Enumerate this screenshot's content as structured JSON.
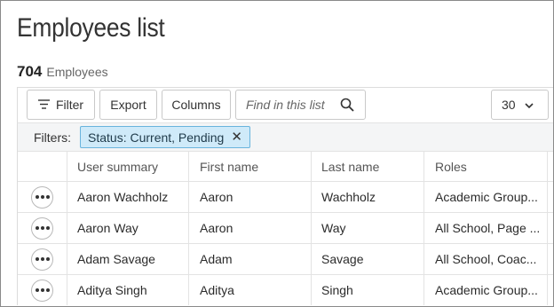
{
  "page": {
    "title": "Employees list",
    "count": "704",
    "count_label": "Employees"
  },
  "toolbar": {
    "filter_label": "Filter",
    "export_label": "Export",
    "columns_label": "Columns",
    "search_placeholder": "Find in this list",
    "page_size": "30"
  },
  "filters": {
    "label": "Filters:",
    "chips": [
      {
        "text": "Status: Current, Pending"
      }
    ]
  },
  "table": {
    "columns": [
      "User summary",
      "First name",
      "Last name",
      "Roles"
    ],
    "rows": [
      {
        "summary": "Aaron Wachholz",
        "first": "Aaron",
        "last": "Wachholz",
        "roles": "Academic Group..."
      },
      {
        "summary": "Aaron Way",
        "first": "Aaron",
        "last": "Way",
        "roles": "All School, Page ..."
      },
      {
        "summary": "Adam Savage",
        "first": "Adam",
        "last": "Savage",
        "roles": "All School, Coac..."
      },
      {
        "summary": "Aditya Singh",
        "first": "Aditya",
        "last": "Singh",
        "roles": "Academic Group..."
      }
    ]
  },
  "icons": {
    "filter": "filter-lines-icon",
    "search": "magnifier-icon",
    "dropdown": "chevron-down-icon",
    "chip_close": "x-close-icon",
    "row_menu": "ellipsis-icon"
  },
  "colors": {
    "chip_background": "#cfeaf9",
    "chip_border": "#69b4dd",
    "filters_bar": "#f4f5f6"
  }
}
